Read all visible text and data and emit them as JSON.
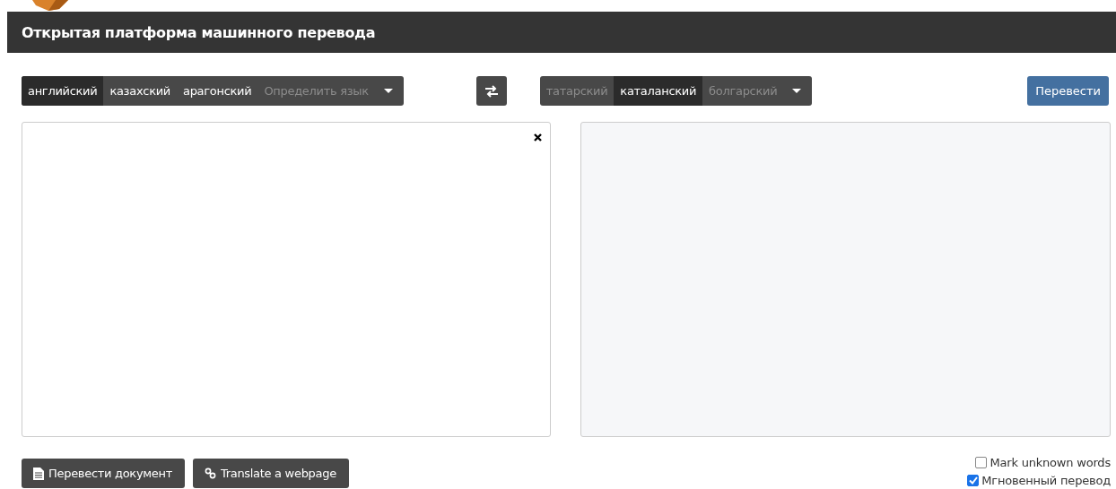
{
  "header": {
    "title": "Открытая платформа машинного перевода"
  },
  "source_languages": [
    {
      "label": "английский",
      "selected": true
    },
    {
      "label": "казахский",
      "selected": false
    },
    {
      "label": "арагонский",
      "selected": false
    },
    {
      "label": "Определить язык",
      "selected": false,
      "disabled": true
    }
  ],
  "target_languages": [
    {
      "label": "татарский",
      "selected": false,
      "disabled": true
    },
    {
      "label": "каталанский",
      "selected": true,
      "disabled": false
    },
    {
      "label": "болгарский",
      "selected": false,
      "disabled": true
    }
  ],
  "translate_button": "Перевести",
  "bottom_buttons": [
    {
      "kind": "document",
      "label": "Перевести документ"
    },
    {
      "kind": "link",
      "label": "Translate a webpage"
    }
  ],
  "options": [
    {
      "label": "Mark unknown words",
      "checked": false
    },
    {
      "label": "Мгновенный перевод",
      "checked": true
    }
  ]
}
